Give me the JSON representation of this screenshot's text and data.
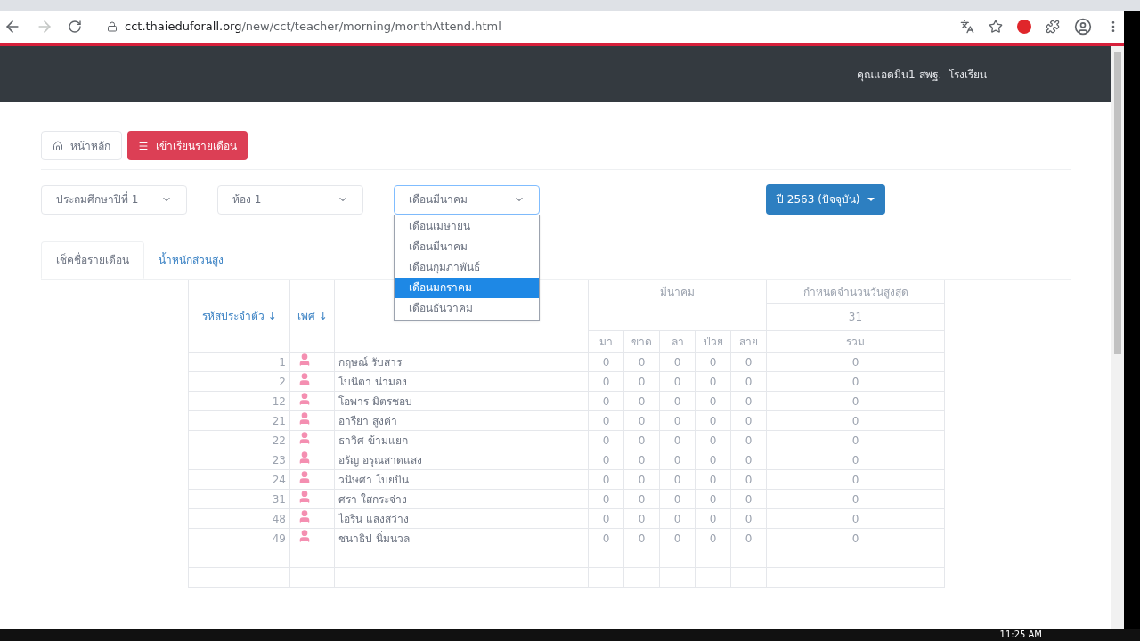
{
  "browser": {
    "url_host": "cct.thaieduforall.org",
    "url_path": "/new/cct/teacher/morning/monthAttend.html"
  },
  "navbar": {
    "user": "คุณแอดมิน1 สพฐ.  โรงเรียน"
  },
  "buttons": [
    {
      "label": "หน้าหลัก",
      "kind": "home"
    },
    {
      "label": "เข้าเรียนรายเดือน",
      "kind": "primary"
    }
  ],
  "selects": [
    {
      "value": "ประถมศึกษาปีที่ 1",
      "open": false
    },
    {
      "value": "ห้อง 1",
      "open": false
    },
    {
      "value": "เดือนมีนาคม",
      "open": true
    }
  ],
  "month_options": [
    {
      "label": "เดือนเมษายน",
      "selected": false
    },
    {
      "label": "เดือนมีนาคม",
      "selected": false
    },
    {
      "label": "เดือนกุมภาพันธ์",
      "selected": false
    },
    {
      "label": "เดือนมกราคม",
      "selected": true
    },
    {
      "label": "เดือนธันวาคม",
      "selected": false
    }
  ],
  "year_button": "ปี 2563 (ปัจจุบัน)",
  "tabs": [
    {
      "label": "เช็คชื่อรายเดือน",
      "selected": true
    },
    {
      "label": "น้ำหนักส่วนสูง",
      "selected": false
    }
  ],
  "table": {
    "id_header": "รหัสประจำตัว ↓",
    "gender_header": "เพศ ↓",
    "month_header": "มีนาคม",
    "max_header": "กำหนดจำนวนวันสูงสุด",
    "max_days": "31",
    "status_headers": [
      "มา",
      "ขาด",
      "ลา",
      "ป่วย",
      "สาย"
    ],
    "total_header": "รวม",
    "rows": [
      {
        "id": "1",
        "name": "กฤษณ์ รับสาร",
        "values": [
          "0",
          "0",
          "0",
          "0",
          "0"
        ],
        "total": "0"
      },
      {
        "id": "2",
        "name": "โบนิตา น่ามอง",
        "values": [
          "0",
          "0",
          "0",
          "0",
          "0"
        ],
        "total": "0"
      },
      {
        "id": "12",
        "name": "โอพาร มิตรชอบ",
        "values": [
          "0",
          "0",
          "0",
          "0",
          "0"
        ],
        "total": "0"
      },
      {
        "id": "21",
        "name": "อารียา สูงค่า",
        "values": [
          "0",
          "0",
          "0",
          "0",
          "0"
        ],
        "total": "0"
      },
      {
        "id": "22",
        "name": "ธาวิศ ข้ามแยก",
        "values": [
          "0",
          "0",
          "0",
          "0",
          "0"
        ],
        "total": "0"
      },
      {
        "id": "23",
        "name": "อรัญ อรุณสาดแสง",
        "values": [
          "0",
          "0",
          "0",
          "0",
          "0"
        ],
        "total": "0"
      },
      {
        "id": "24",
        "name": "วนิษศา โบยบิน",
        "values": [
          "0",
          "0",
          "0",
          "0",
          "0"
        ],
        "total": "0"
      },
      {
        "id": "31",
        "name": "ศรา ใสกระจ่าง",
        "values": [
          "0",
          "0",
          "0",
          "0",
          "0"
        ],
        "total": "0"
      },
      {
        "id": "48",
        "name": "ไอริน แสงสว่าง",
        "values": [
          "0",
          "0",
          "0",
          "0",
          "0"
        ],
        "total": "0"
      },
      {
        "id": "49",
        "name": "ชนาธิป นิ่มนวล",
        "values": [
          "0",
          "0",
          "0",
          "0",
          "0"
        ],
        "total": "0"
      }
    ]
  },
  "taskbar": {
    "clock": "11:25 AM"
  }
}
